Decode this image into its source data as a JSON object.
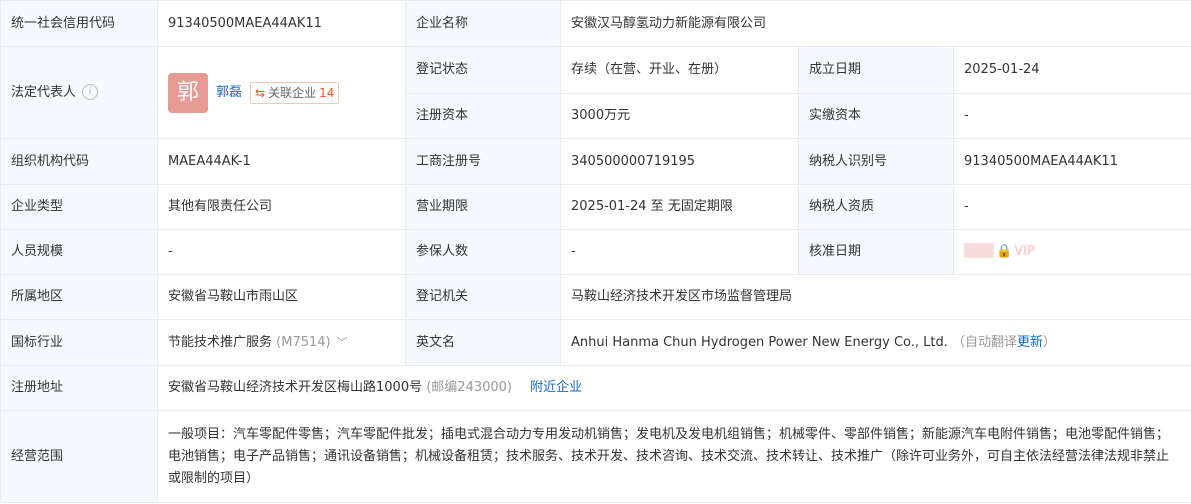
{
  "labels": {
    "credit_code": "统一社会信用代码",
    "company_name": "企业名称",
    "legal_rep": "法定代表人",
    "reg_status": "登记状态",
    "established": "成立日期",
    "reg_capital": "注册资本",
    "paid_capital": "实缴资本",
    "org_code": "组织机构代码",
    "biz_reg_no": "工商注册号",
    "taxpayer_id": "纳税人识别号",
    "company_type": "企业类型",
    "biz_term": "营业期限",
    "taxpayer_qual": "纳税人资质",
    "staff_size": "人员规模",
    "insured": "参保人数",
    "approval_date": "核准日期",
    "region": "所属地区",
    "reg_authority": "登记机关",
    "industry": "国标行业",
    "english_name": "英文名",
    "reg_address": "注册地址",
    "biz_scope": "经营范围"
  },
  "values": {
    "credit_code": "91340500MAEA44AK11",
    "company_name": "安徽汉马醇氢动力新能源有限公司",
    "rep_avatar": "郭",
    "rep_name": "郭磊",
    "related_label": "关联企业",
    "related_count": "14",
    "reg_status": "存续（在营、开业、在册）",
    "established": "2025-01-24",
    "reg_capital": "3000万元",
    "paid_capital": "-",
    "org_code": "MAEA44AK-1",
    "biz_reg_no": "340500000719195",
    "taxpayer_id": "91340500MAEA44AK11",
    "company_type": "其他有限责任公司",
    "biz_term": "2025-01-24 至 无固定期限",
    "taxpayer_qual": "-",
    "staff_size": "-",
    "insured": "-",
    "approval_date_suffix": "VIP",
    "region": "安徽省马鞍山市雨山区",
    "reg_authority": "马鞍山经济技术开发区市场监督管理局",
    "industry": "节能技术推广服务",
    "industry_code": "(M7514)",
    "english_name": "Anhui Hanma Chun Hydrogen Power New Energy Co., Ltd.",
    "auto_translate": "（自动翻译",
    "update": "更新",
    "close_paren": "）",
    "reg_address": "安徽省马鞍山经济技术开发区梅山路1000号",
    "postcode": "(邮编243000)",
    "nearby": "附近企业",
    "biz_scope": "一般项目：汽车零配件零售；汽车零配件批发；插电式混合动力专用发动机销售；发电机及发电机组销售；机械零件、零部件销售；新能源汽车电附件销售；电池零配件销售；电池销售；电子产品销售；通讯设备销售；机械设备租赁；技术服务、技术开发、技术咨询、技术交流、技术转让、技术推广（除许可业务外，可自主依法经营法律法规非禁止或限制的项目）"
  },
  "icons": [
    "info-icon",
    "related-company-icon",
    "chevron-down-icon",
    "lock-icon"
  ]
}
